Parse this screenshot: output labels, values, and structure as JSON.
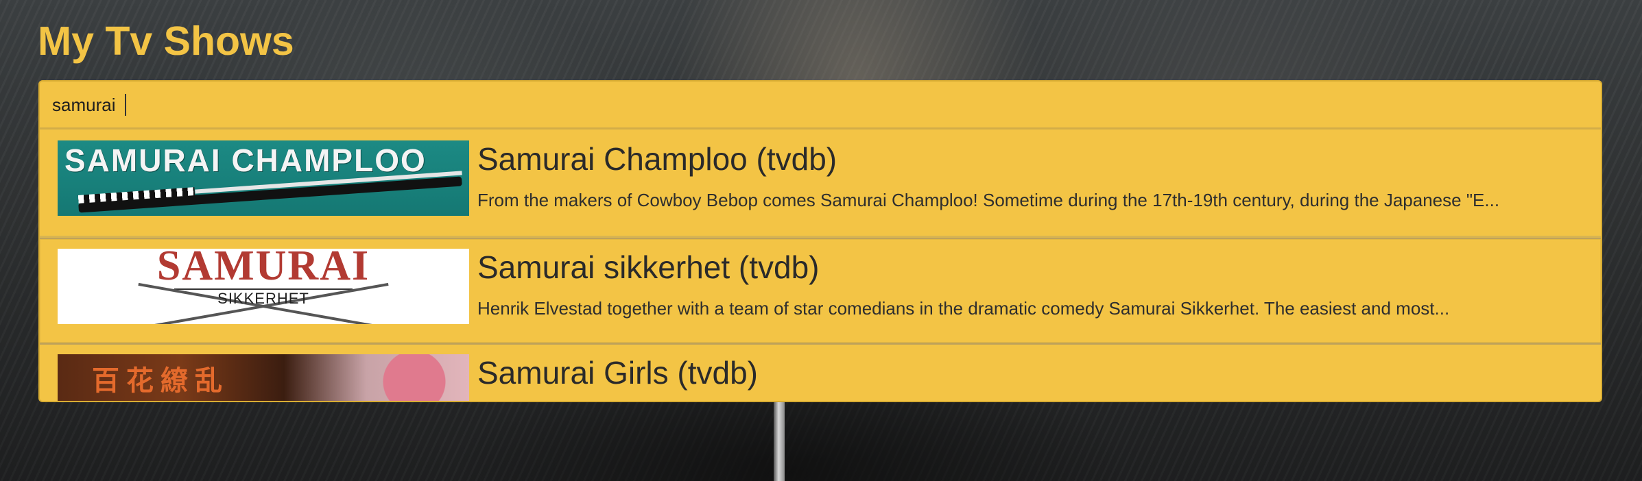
{
  "page": {
    "title": "My Tv Shows"
  },
  "search": {
    "value": "samurai",
    "placeholder": ""
  },
  "results": [
    {
      "title": "Samurai Champloo (tvdb)",
      "description": "From the makers of Cowboy Bebop comes Samurai Champloo! Sometime during the 17th-19th century, during the Japanese \"E...",
      "thumbnail_text": "SAMURAI CHAMPLOO"
    },
    {
      "title": "Samurai sikkerhet (tvdb)",
      "description": "Henrik Elvestad together with a team of star comedians in the dramatic comedy Samurai Sikkerhet. The easiest and most...",
      "thumbnail_text": "SAMURAI",
      "thumbnail_subtext": "SIKKERHET"
    },
    {
      "title": "Samurai Girls (tvdb)",
      "description": "",
      "thumbnail_text": "百花繚乱"
    }
  ],
  "colors": {
    "accent": "#f3c445",
    "title_text": "#f3c445",
    "panel_border": "#d9ad33",
    "text_dark": "#2a2a2a"
  }
}
